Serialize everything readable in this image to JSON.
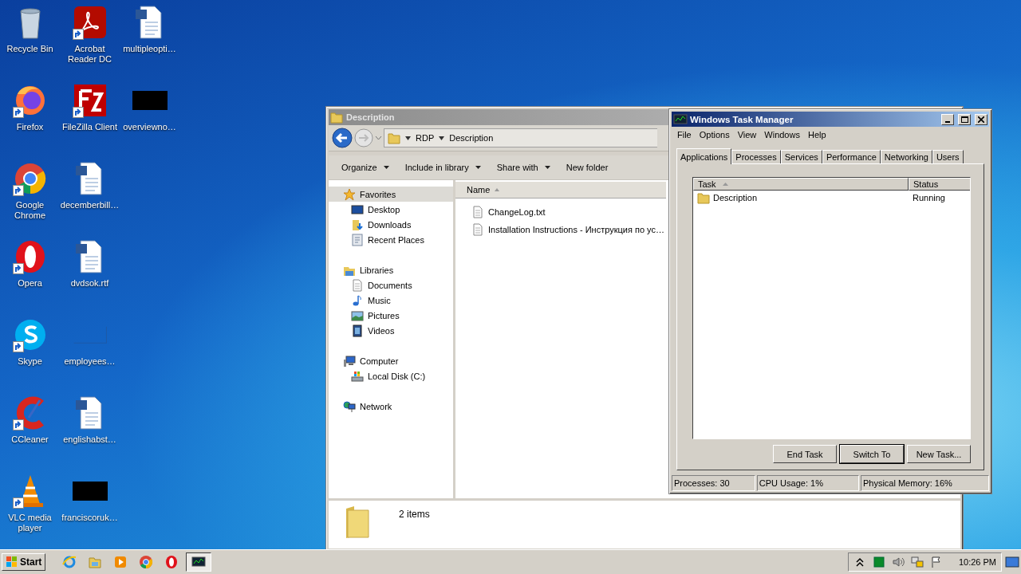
{
  "desktop_icons": [
    {
      "label": "Recycle Bin",
      "kind": "bin",
      "shortcut": false
    },
    {
      "label": "Firefox",
      "kind": "firefox",
      "shortcut": true
    },
    {
      "label": "Google Chrome",
      "kind": "chrome",
      "shortcut": true
    },
    {
      "label": "Opera",
      "kind": "opera",
      "shortcut": true
    },
    {
      "label": "Skype",
      "kind": "skype",
      "shortcut": true
    },
    {
      "label": "CCleaner",
      "kind": "ccleaner",
      "shortcut": true
    },
    {
      "label": "VLC media player",
      "kind": "vlc",
      "shortcut": true
    },
    {
      "label": "Acrobat Reader DC",
      "kind": "pdf",
      "shortcut": true
    },
    {
      "label": "FileZilla Client",
      "kind": "filezilla",
      "shortcut": true
    },
    {
      "label": "decemberbill…",
      "kind": "word",
      "shortcut": false
    },
    {
      "label": "dvdsok.rtf",
      "kind": "word",
      "shortcut": false
    },
    {
      "label": "employees…",
      "kind": "blank",
      "shortcut": false
    },
    {
      "label": "englishabst…",
      "kind": "word",
      "shortcut": false
    },
    {
      "label": "franciscoruk…",
      "kind": "black",
      "shortcut": false
    },
    {
      "label": "multipleopti…",
      "kind": "word",
      "shortcut": false
    },
    {
      "label": "overviewno…",
      "kind": "black",
      "shortcut": false
    }
  ],
  "explorer": {
    "title": "Description",
    "breadcrumb": [
      "RDP",
      "Description"
    ],
    "toolbar": [
      {
        "label": "Organize",
        "menu": true
      },
      {
        "label": "Include in library",
        "menu": true
      },
      {
        "label": "Share with",
        "menu": true
      },
      {
        "label": "New folder",
        "menu": false
      }
    ],
    "nav": [
      {
        "label": "Favorites",
        "kind": "star",
        "selected": true,
        "children": [
          {
            "label": "Desktop",
            "kind": "desktop",
            "selected": false
          },
          {
            "label": "Downloads",
            "kind": "downloads",
            "selected": false
          },
          {
            "label": "Recent Places",
            "kind": "recent",
            "selected": false
          }
        ]
      },
      {
        "label": "Libraries",
        "kind": "libraries",
        "selected": false,
        "children": [
          {
            "label": "Documents",
            "kind": "documents",
            "selected": false
          },
          {
            "label": "Music",
            "kind": "music",
            "selected": false
          },
          {
            "label": "Pictures",
            "kind": "pictures",
            "selected": false
          },
          {
            "label": "Videos",
            "kind": "videos",
            "selected": false
          }
        ]
      },
      {
        "label": "Computer",
        "kind": "computer",
        "selected": false,
        "children": [
          {
            "label": "Local Disk (C:)",
            "kind": "disk",
            "selected": false
          }
        ]
      },
      {
        "label": "Network",
        "kind": "network",
        "selected": false
      }
    ],
    "column": "Name",
    "files": [
      {
        "name": "ChangeLog.txt"
      },
      {
        "name": "Installation Instructions - Инструкция по ус…"
      }
    ],
    "details": "2 items"
  },
  "task_manager": {
    "title": "Windows Task Manager",
    "menu": [
      "File",
      "Options",
      "View",
      "Windows",
      "Help"
    ],
    "tabs": [
      {
        "label": "Applications",
        "selected": true
      },
      {
        "label": "Processes",
        "selected": false
      },
      {
        "label": "Services",
        "selected": false
      },
      {
        "label": "Performance",
        "selected": false
      },
      {
        "label": "Networking",
        "selected": false
      },
      {
        "label": "Users",
        "selected": false
      }
    ],
    "columns": [
      "Task",
      "Status"
    ],
    "rows": [
      {
        "task": "Description",
        "status": "Running"
      }
    ],
    "buttons": [
      {
        "label": "End Task",
        "focused": false
      },
      {
        "label": "Switch To",
        "focused": true
      },
      {
        "label": "New Task...",
        "focused": false
      }
    ],
    "status_bar": [
      "Processes: 30",
      "CPU Usage: 1%",
      "Physical Memory: 16%"
    ]
  },
  "taskbar": {
    "start": "Start",
    "apps": [
      {
        "kind": "ie",
        "active": false
      },
      {
        "kind": "explorer",
        "active": false
      },
      {
        "kind": "media",
        "active": false
      },
      {
        "kind": "chrome",
        "active": false
      },
      {
        "kind": "opera",
        "active": false
      },
      {
        "kind": "taskmgr",
        "active": true
      }
    ],
    "tray": [
      {
        "kind": "chevron"
      },
      {
        "kind": "green"
      },
      {
        "kind": "speaker"
      },
      {
        "kind": "network"
      },
      {
        "kind": "flag"
      }
    ],
    "clock": "10:26 PM"
  }
}
